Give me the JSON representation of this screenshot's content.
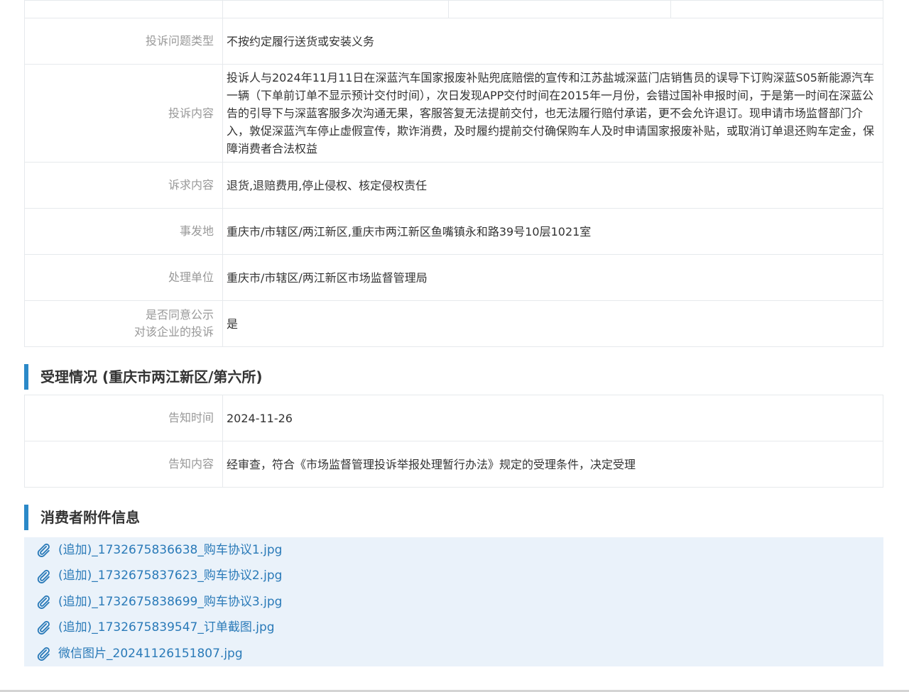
{
  "complaint": {
    "rows": [
      {
        "label_lines": [
          "投诉问题类型"
        ],
        "value": "不按约定履行送货或安装义务"
      },
      {
        "label_lines": [
          "投诉内容"
        ],
        "value": "投诉人与2024年11月11日在深蓝汽车国家报废补贴兜底赔偿的宣传和江苏盐城深蓝门店销售员的误导下订购深蓝S05新能源汽车一辆（下单前订单不显示预计交付时间），次日发现APP交付时间在2015年一月份，会错过国补申报时间，于是第一时间在深蓝公告的引导下与深蓝客服多次沟通无果，客服答复无法提前交付，也无法履行赔付承诺，更不会允许退订。现申请市场监督部门介入，敦促深蓝汽车停止虚假宣传，欺诈消费，及时履约提前交付确保购车人及时申请国家报废补贴，或取消订单退还购车定金，保障消费者合法权益"
      },
      {
        "label_lines": [
          "诉求内容"
        ],
        "value": "退货,退赔费用,停止侵权、核定侵权责任"
      },
      {
        "label_lines": [
          "事发地"
        ],
        "value": "重庆市/市辖区/两江新区,重庆市两江新区鱼嘴镇永和路39号10层1021室"
      },
      {
        "label_lines": [
          "处理单位"
        ],
        "value": "重庆市/市辖区/两江新区市场监督管理局"
      },
      {
        "label_lines": [
          "是否同意公示",
          "对该企业的投诉"
        ],
        "value": "是"
      }
    ]
  },
  "acceptance": {
    "title": "受理情况 (重庆市两江新区/第六所)",
    "rows": [
      {
        "label": "告知时间",
        "value": "2024-11-26"
      },
      {
        "label": "告知内容",
        "value": "经审查，符合《市场监督管理投诉举报处理暂行办法》规定的受理条件，决定受理"
      }
    ]
  },
  "attachments": {
    "title": "消费者附件信息",
    "icon": "paperclip-icon",
    "items": [
      "(追加)_1732675836638_购车协议1.jpg",
      "(追加)_1732675837623_购车协议2.jpg",
      "(追加)_1732675838699_购车协议3.jpg",
      "(追加)_1732675839547_订单截图.jpg",
      "微信图片_20241126151807.jpg"
    ]
  },
  "colors": {
    "accent_bar": "#2b89c8",
    "link": "#2a7ab8",
    "attach_bg": "#eaf2fa",
    "label": "#999999",
    "border": "#e6e9ec"
  }
}
